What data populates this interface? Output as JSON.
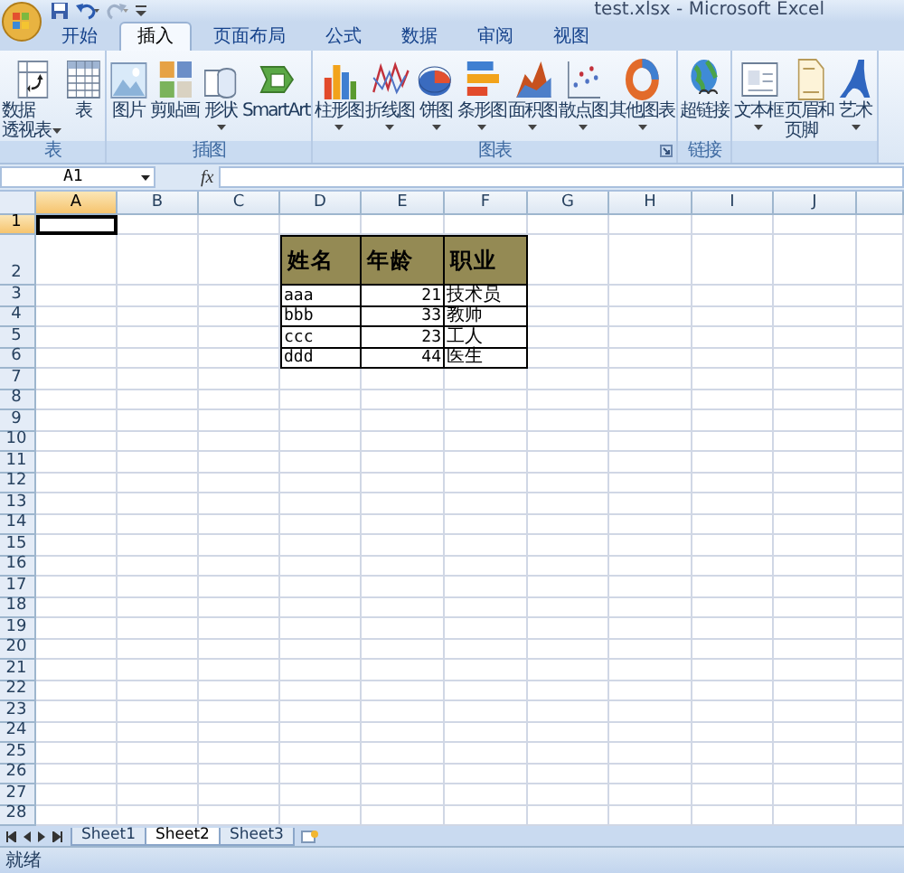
{
  "window": {
    "title": "test.xlsx - Microsoft Excel"
  },
  "tabs": [
    {
      "label": "开始",
      "selected": false
    },
    {
      "label": "插入",
      "selected": true
    },
    {
      "label": "页面布局",
      "selected": false
    },
    {
      "label": "公式",
      "selected": false
    },
    {
      "label": "数据",
      "selected": false
    },
    {
      "label": "审阅",
      "selected": false
    },
    {
      "label": "视图",
      "selected": false
    }
  ],
  "ribbon": {
    "groups": [
      {
        "label": "表",
        "buttons": [
          {
            "lines": [
              "数据",
              "透视表"
            ],
            "dropdown": true
          },
          {
            "lines": [
              "表"
            ],
            "dropdown": false
          }
        ]
      },
      {
        "label": "插图",
        "buttons": [
          {
            "lines": [
              "图片"
            ],
            "dropdown": false
          },
          {
            "lines": [
              "剪贴画"
            ],
            "dropdown": false
          },
          {
            "lines": [
              "形状"
            ],
            "dropdown": true
          },
          {
            "lines": [
              "SmartArt"
            ],
            "dropdown": false
          }
        ]
      },
      {
        "label": "图表",
        "launcher": true,
        "buttons": [
          {
            "lines": [
              "柱形图"
            ],
            "dropdown": true
          },
          {
            "lines": [
              "折线图"
            ],
            "dropdown": true
          },
          {
            "lines": [
              "饼图"
            ],
            "dropdown": true
          },
          {
            "lines": [
              "条形图"
            ],
            "dropdown": true
          },
          {
            "lines": [
              "面积图"
            ],
            "dropdown": true
          },
          {
            "lines": [
              "散点图"
            ],
            "dropdown": true
          },
          {
            "lines": [
              "其他图表"
            ],
            "dropdown": true
          }
        ]
      },
      {
        "label": "链接",
        "buttons": [
          {
            "lines": [
              "超链接"
            ],
            "dropdown": false
          }
        ]
      },
      {
        "buttons": [
          {
            "lines": [
              "文本框"
            ],
            "dropdown": true
          },
          {
            "lines": [
              "页眉和",
              "页脚"
            ],
            "dropdown": false
          },
          {
            "lines": [
              "艺术"
            ],
            "dropdown": true
          }
        ]
      }
    ]
  },
  "formula_bar": {
    "name_box": "A1",
    "function_label": "fx"
  },
  "sheet": {
    "columns": [
      {
        "label": "A",
        "selected": true
      },
      {
        "label": "B",
        "selected": false
      },
      {
        "label": "C",
        "selected": false
      },
      {
        "label": "D",
        "selected": false
      },
      {
        "label": "E",
        "selected": false
      },
      {
        "label": "F",
        "selected": false
      },
      {
        "label": "G",
        "selected": false
      },
      {
        "label": "H",
        "selected": false
      },
      {
        "label": "I",
        "selected": false
      },
      {
        "label": "J",
        "selected": false
      }
    ],
    "rows": [
      {
        "label": "1",
        "selected": true
      },
      {
        "label": "2",
        "selected": false
      },
      {
        "label": "3",
        "selected": false
      },
      {
        "label": "4",
        "selected": false
      },
      {
        "label": "5",
        "selected": false
      },
      {
        "label": "6",
        "selected": false
      },
      {
        "label": "7",
        "selected": false
      },
      {
        "label": "8",
        "selected": false
      },
      {
        "label": "9",
        "selected": false
      },
      {
        "label": "10",
        "selected": false
      },
      {
        "label": "11",
        "selected": false
      },
      {
        "label": "12",
        "selected": false
      },
      {
        "label": "13",
        "selected": false
      },
      {
        "label": "14",
        "selected": false
      },
      {
        "label": "15",
        "selected": false
      },
      {
        "label": "16",
        "selected": false
      },
      {
        "label": "17",
        "selected": false
      },
      {
        "label": "18",
        "selected": false
      },
      {
        "label": "19",
        "selected": false
      },
      {
        "label": "20",
        "selected": false
      },
      {
        "label": "21",
        "selected": false
      },
      {
        "label": "22",
        "selected": false
      },
      {
        "label": "23",
        "selected": false
      },
      {
        "label": "24",
        "selected": false
      },
      {
        "label": "25",
        "selected": false
      },
      {
        "label": "26",
        "selected": false
      },
      {
        "label": "27",
        "selected": false
      },
      {
        "label": "28",
        "selected": false
      }
    ],
    "table": {
      "columns": [
        "姓名",
        "年龄",
        "职业"
      ],
      "rows": [
        [
          "aaa",
          "21",
          "技术员"
        ],
        [
          "bbb",
          "33",
          "教师"
        ],
        [
          "ccc",
          "23",
          "工人"
        ],
        [
          "ddd",
          "44",
          "医生"
        ]
      ]
    }
  },
  "sheet_tabs": [
    {
      "label": "Sheet1",
      "selected": false
    },
    {
      "label": "Sheet2",
      "selected": true
    },
    {
      "label": "Sheet3",
      "selected": false
    }
  ],
  "status_bar": {
    "text": "就绪"
  }
}
